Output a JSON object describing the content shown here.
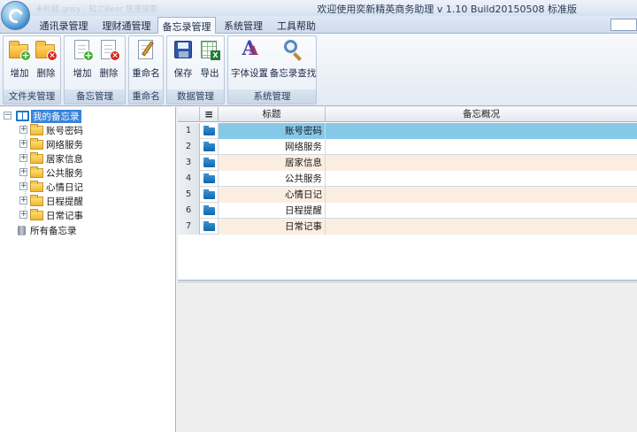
{
  "window": {
    "ghost_text": "未标题.gnsy - 知之Beer 快速搜索",
    "title": "欢迎使用奕新精英商务助理  v 1.10 Build20150508  标准版"
  },
  "tabs": [
    {
      "label": "通讯录管理"
    },
    {
      "label": "理财通管理"
    },
    {
      "label": "备忘录管理",
      "active": true
    },
    {
      "label": "系统管理"
    },
    {
      "label": "工具帮助"
    }
  ],
  "ribbon": {
    "groups": [
      {
        "label": "文件夹管理",
        "buttons": [
          {
            "label": "增加",
            "icon": "folder-add-icon"
          },
          {
            "label": "删除",
            "icon": "folder-delete-icon"
          }
        ]
      },
      {
        "label": "备忘管理",
        "buttons": [
          {
            "label": "增加",
            "icon": "memo-add-icon"
          },
          {
            "label": "删除",
            "icon": "memo-delete-icon"
          }
        ]
      },
      {
        "label": "重命名",
        "buttons": [
          {
            "label": "重命名",
            "icon": "rename-icon"
          }
        ]
      },
      {
        "label": "数据管理",
        "buttons": [
          {
            "label": "保存",
            "icon": "save-icon"
          },
          {
            "label": "导出",
            "icon": "export-excel-icon"
          }
        ]
      },
      {
        "label": "系统管理",
        "buttons": [
          {
            "label": "字体设置",
            "icon": "font-settings-icon"
          },
          {
            "label": "备忘录查找",
            "icon": "search-icon"
          }
        ]
      }
    ]
  },
  "tree": {
    "root": "我的备忘录",
    "children": [
      "账号密码",
      "网络服务",
      "居家信息",
      "公共服务",
      "心情日记",
      "日程提醒",
      "日常记事"
    ],
    "all_label": "所有备忘录"
  },
  "grid": {
    "columns": {
      "menu": "≡",
      "title": "标题",
      "summary": "备忘概况"
    },
    "rows": [
      {
        "num": "1",
        "title": "账号密码",
        "summary": ""
      },
      {
        "num": "2",
        "title": "网络服务",
        "summary": ""
      },
      {
        "num": "3",
        "title": "居家信息",
        "summary": ""
      },
      {
        "num": "4",
        "title": "公共服务",
        "summary": ""
      },
      {
        "num": "5",
        "title": "心情日记",
        "summary": ""
      },
      {
        "num": "6",
        "title": "日程提醒",
        "summary": ""
      },
      {
        "num": "7",
        "title": "日常记事",
        "summary": ""
      }
    ],
    "selected_row": 0
  },
  "colors": {
    "selection": "#86c8e8",
    "alt_row": "#fbeee1",
    "tree_selection": "#3b82d9"
  }
}
